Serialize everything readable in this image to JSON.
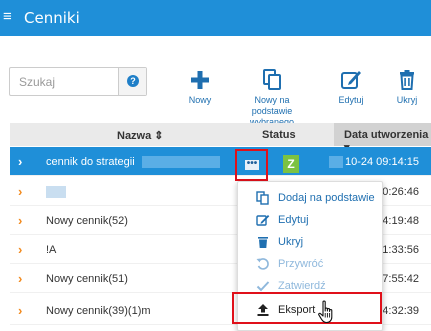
{
  "header": {
    "menu_icon": "hamburger-icon",
    "title": "Cenniki"
  },
  "search": {
    "placeholder": "Szukaj",
    "help_label": "?"
  },
  "toolbar": [
    {
      "label": "Nowy",
      "icon": "plus-icon"
    },
    {
      "label": "Nowy na podstawie wybranego",
      "icon": "copy-icon"
    },
    {
      "label": "Edytuj",
      "icon": "edit-icon"
    },
    {
      "label": "Ukryj",
      "icon": "trash-icon"
    }
  ],
  "table": {
    "columns": {
      "name": "Nazwa ⇕",
      "status": "Status",
      "date": "Data utworzenia ▾"
    },
    "rows": [
      {
        "name": "cennik do strategii",
        "status": "Z",
        "date": "10-24 09:14:15",
        "selected": true
      },
      {
        "name": "",
        "status": "",
        "date": "10:26:46",
        "selected": false
      },
      {
        "name": "Nowy cennik(52)",
        "status": "",
        "date": "14:19:48",
        "selected": false
      },
      {
        "name": "!A",
        "status": "",
        "date": "11:33:56",
        "selected": false
      },
      {
        "name": "Nowy cennik(51)",
        "status": "",
        "date": "07:55:42",
        "selected": false
      },
      {
        "name": "Nowy cennik(39)(1)m",
        "status": "",
        "date": "14:32:39",
        "selected": false
      }
    ]
  },
  "row_menu_button": {
    "label": "•••"
  },
  "context_menu": [
    {
      "label": "Dodaj na podstawie",
      "icon": "copy-icon",
      "disabled": false
    },
    {
      "label": "Edytuj",
      "icon": "edit-icon",
      "disabled": false
    },
    {
      "label": "Ukryj",
      "icon": "trash-icon",
      "disabled": false
    },
    {
      "label": "Przywróć",
      "icon": "undo-icon",
      "disabled": true
    },
    {
      "label": "Zatwierdź",
      "icon": "check-icon",
      "disabled": true
    },
    {
      "label": "Eksport",
      "icon": "upload-icon",
      "disabled": false
    }
  ],
  "colors": {
    "header": "#1f8fd8",
    "selected_row": "#1f8fd8",
    "highlight": "#e0101a",
    "status_green": "#7cc242",
    "chevron": "#f28a1e"
  }
}
